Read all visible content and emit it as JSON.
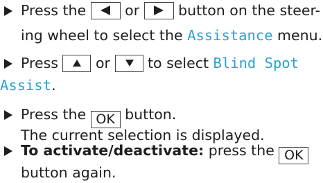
{
  "colors": {
    "text": "#1f1f1f",
    "display_text": "#2aa0d4"
  },
  "icons": {
    "bullet": "triangle-right-bullet-icon",
    "left_button": "triangle-left-icon",
    "right_button": "triangle-right-icon",
    "up_button": "triangle-up-icon",
    "down_button": "triangle-down-icon"
  },
  "steps": [
    {
      "line1_a": "Press the ",
      "line1_b": " or ",
      "line1_c": " button on the steer-",
      "line2_a": "ing wheel to select the ",
      "line2_display": "Assistance",
      "line2_b": " menu."
    },
    {
      "line1_a": "Press ",
      "line1_b": " or ",
      "line1_c": " to select ",
      "line1_display": "Blind Spot",
      "line2_display": "Assist",
      "line2_b": "."
    },
    {
      "line1_a": "Press the ",
      "ok_label": "OK",
      "line1_b": " button.",
      "line2": "The current selection is displayed."
    },
    {
      "bold_label": "To activate/deactivate:",
      "line1_a": " press the ",
      "ok_label": "OK",
      "line2": "button again."
    }
  ]
}
